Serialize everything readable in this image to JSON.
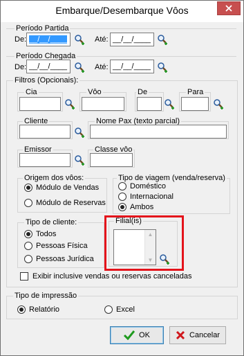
{
  "window": {
    "title": "Embarque/Desembarque Vôos",
    "close_icon": "close-icon"
  },
  "periodo_partida": {
    "label": "Período Partida",
    "de_label": "De:",
    "de_value": "__/__/____",
    "ate_label": "Até:",
    "ate_value": "__/__/____"
  },
  "periodo_chegada": {
    "label": "Período Chegada",
    "de_label": "De:",
    "de_value": "__/__/____",
    "ate_label": "Até:",
    "ate_value": "__/__/____"
  },
  "filtros": {
    "label": "Filtros (Opcionais):",
    "cia_label": "Cia",
    "voo_label": "Vôo",
    "de_label": "De",
    "para_label": "Para",
    "cliente_label": "Cliente",
    "nome_pax_label": "Nome Pax (texto parcial)",
    "emissor_label": "Emissor",
    "classe_voo_label": "Classe vôo"
  },
  "origem": {
    "label": "Origem dos vôos:",
    "options": [
      "Módulo de Vendas",
      "Módulo de Reservas"
    ],
    "selected": "Módulo de Vendas"
  },
  "tipo_viagem": {
    "label": "Tipo de viagem (venda/reserva)",
    "options": [
      "Doméstico",
      "Internacional",
      "Ambos"
    ],
    "selected": "Ambos"
  },
  "tipo_cliente": {
    "label": "Tipo de cliente:",
    "options": [
      "Todos",
      "Pessoas Física",
      "Pessoas Jurídica"
    ],
    "selected": "Todos"
  },
  "filial": {
    "label": "Filial(is)"
  },
  "exibir_canceladas": {
    "label": "Exibir inclusive vendas ou reservas canceladas",
    "checked": false
  },
  "tipo_impressao": {
    "label": "Tipo de impressão",
    "options": [
      "Relatório",
      "Excel"
    ],
    "selected": "Relatório"
  },
  "buttons": {
    "ok_label": "OK",
    "cancel_label": "Cancelar"
  },
  "colors": {
    "highlight": "#e4131b",
    "close_button": "#c74f4f",
    "selection": "#3399ff"
  }
}
